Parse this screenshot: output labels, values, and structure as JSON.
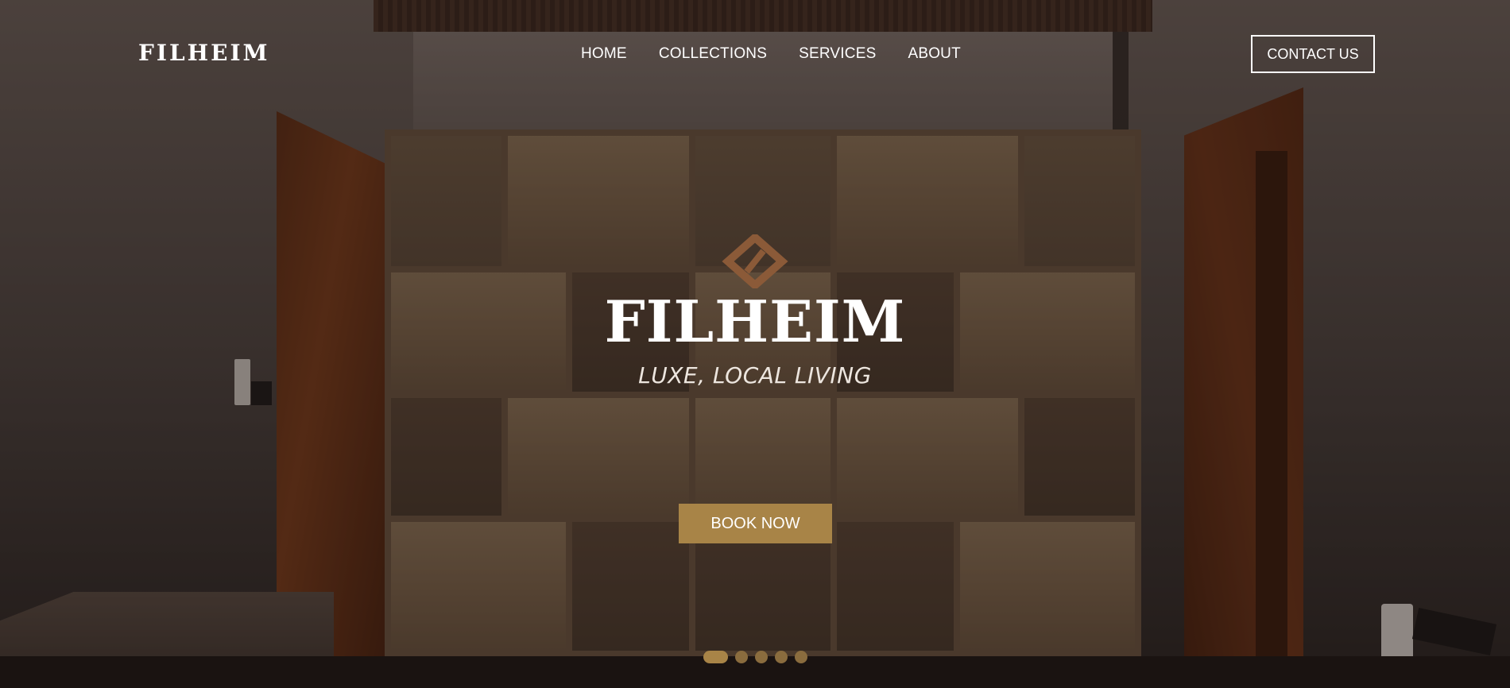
{
  "nav": {
    "brand": "FILHEIM",
    "menu": [
      {
        "label": "HOME"
      },
      {
        "label": "COLLECTIONS"
      },
      {
        "label": "SERVICES"
      },
      {
        "label": "ABOUT"
      }
    ],
    "contact_label": "CONTACT US"
  },
  "hero": {
    "logo_icon": "diamond-logo-icon",
    "title": "FILHEIM",
    "subtitle": "LUXE, LOCAL LIVING",
    "cta_label": "BOOK NOW"
  },
  "slider": {
    "total_slides": 5,
    "active_slide": 1
  },
  "colors": {
    "accent": "#a88447",
    "dot_inactive": "#8a6c3e",
    "text": "#ffffff",
    "logo_icon": "#8b5a38"
  }
}
